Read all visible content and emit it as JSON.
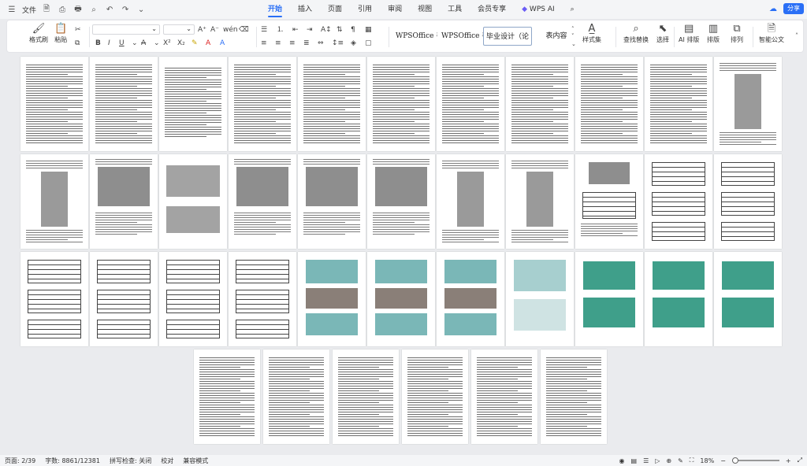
{
  "titlebar": {
    "file_menu": "文件",
    "tabs": [
      {
        "label": "开始",
        "active": true
      },
      {
        "label": "插入"
      },
      {
        "label": "页面"
      },
      {
        "label": "引用"
      },
      {
        "label": "审阅"
      },
      {
        "label": "视图"
      },
      {
        "label": "工具"
      },
      {
        "label": "会员专享"
      },
      {
        "label": "WPS AI"
      }
    ],
    "share_label": "分享"
  },
  "ribbon": {
    "format_painter": "格式刷",
    "paste": "粘贴",
    "style_names": [
      "WPSOffice 手",
      "WPSOffice 手",
      "毕业设计（论",
      "表内容"
    ],
    "styles_label": "样式集",
    "find_replace": "查找替换",
    "select": "选择",
    "ai_layout": "AI 排版",
    "layout": "排版",
    "arrange": "排列",
    "smart_doc": "智能公文"
  },
  "status": {
    "page": "页面: 2/39",
    "words": "字数: 8861/12381",
    "spellcheck": "拼写检查: 关闭",
    "proof": "校对",
    "compat": "兼容模式",
    "zoom": "18%"
  },
  "document": {
    "total_pages": 39
  }
}
